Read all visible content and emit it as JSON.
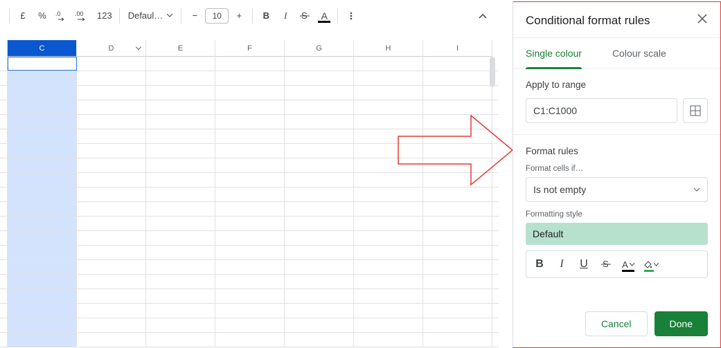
{
  "toolbar": {
    "currency": "£",
    "percent": "%",
    "dec_dec": ".0",
    "dec_inc": ".00",
    "numfmt": "123",
    "font": "Defaul…",
    "size": "10",
    "bold": "B",
    "italic": "I",
    "strike": "S",
    "textcolor": "A"
  },
  "columns": [
    "C",
    "D",
    "E",
    "F",
    "G",
    "H",
    "I"
  ],
  "panel": {
    "title": "Conditional format rules",
    "tab_single": "Single colour",
    "tab_scale": "Colour scale",
    "apply_label": "Apply to range",
    "range_value": "C1:C1000",
    "rules_label": "Format rules",
    "cells_if": "Format cells if…",
    "condition": "Is not empty",
    "style_label": "Formatting style",
    "style_value": "Default",
    "fmt": {
      "bold": "B",
      "italic": "I",
      "underline": "U",
      "strike": "S",
      "text": "A"
    },
    "cancel": "Cancel",
    "done": "Done"
  }
}
